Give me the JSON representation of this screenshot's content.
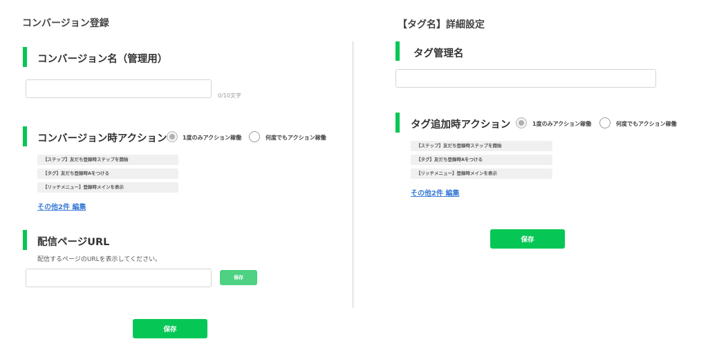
{
  "left": {
    "page_title": "コンバージョン登録",
    "name_section": {
      "title": "コンバージョン名（管理用）",
      "input_value": "",
      "counter": "0/10文字"
    },
    "action_section": {
      "title": "コンバージョン時アクション",
      "radio_once": "1度のみアクション稼働",
      "radio_every": "何度でもアクション稼働",
      "chips": [
        "【ステップ】友だち登録時ステップを開始",
        "【タグ】友だち登録時Aをつける",
        "【リッチメニュー】登録時メインを表示"
      ],
      "more_link": "その他2件 編集"
    },
    "url_section": {
      "title": "配信ページURL",
      "description": "配信するページのURLを表示してください。",
      "input_value": "",
      "save_label": "保存"
    },
    "save_label": "保存"
  },
  "right": {
    "page_title": "【タグ名】詳細設定",
    "name_section": {
      "title": "タグ管理名",
      "input_value": ""
    },
    "action_section": {
      "title": "タグ追加時アクション",
      "radio_once": "1度のみアクション稼働",
      "radio_every": "何度でもアクション稼働",
      "chips": [
        "【ステップ】友だち登録時ステップを開始",
        "【タグ】友だち登録時Aをつける",
        "【リッチメニュー】登録時メインを表示"
      ],
      "more_link": "その他2件 編集"
    },
    "save_label": "保存"
  },
  "colors": {
    "accent": "#06c755",
    "link": "#3a7bd5",
    "chip_bg": "#f0f0f0"
  }
}
